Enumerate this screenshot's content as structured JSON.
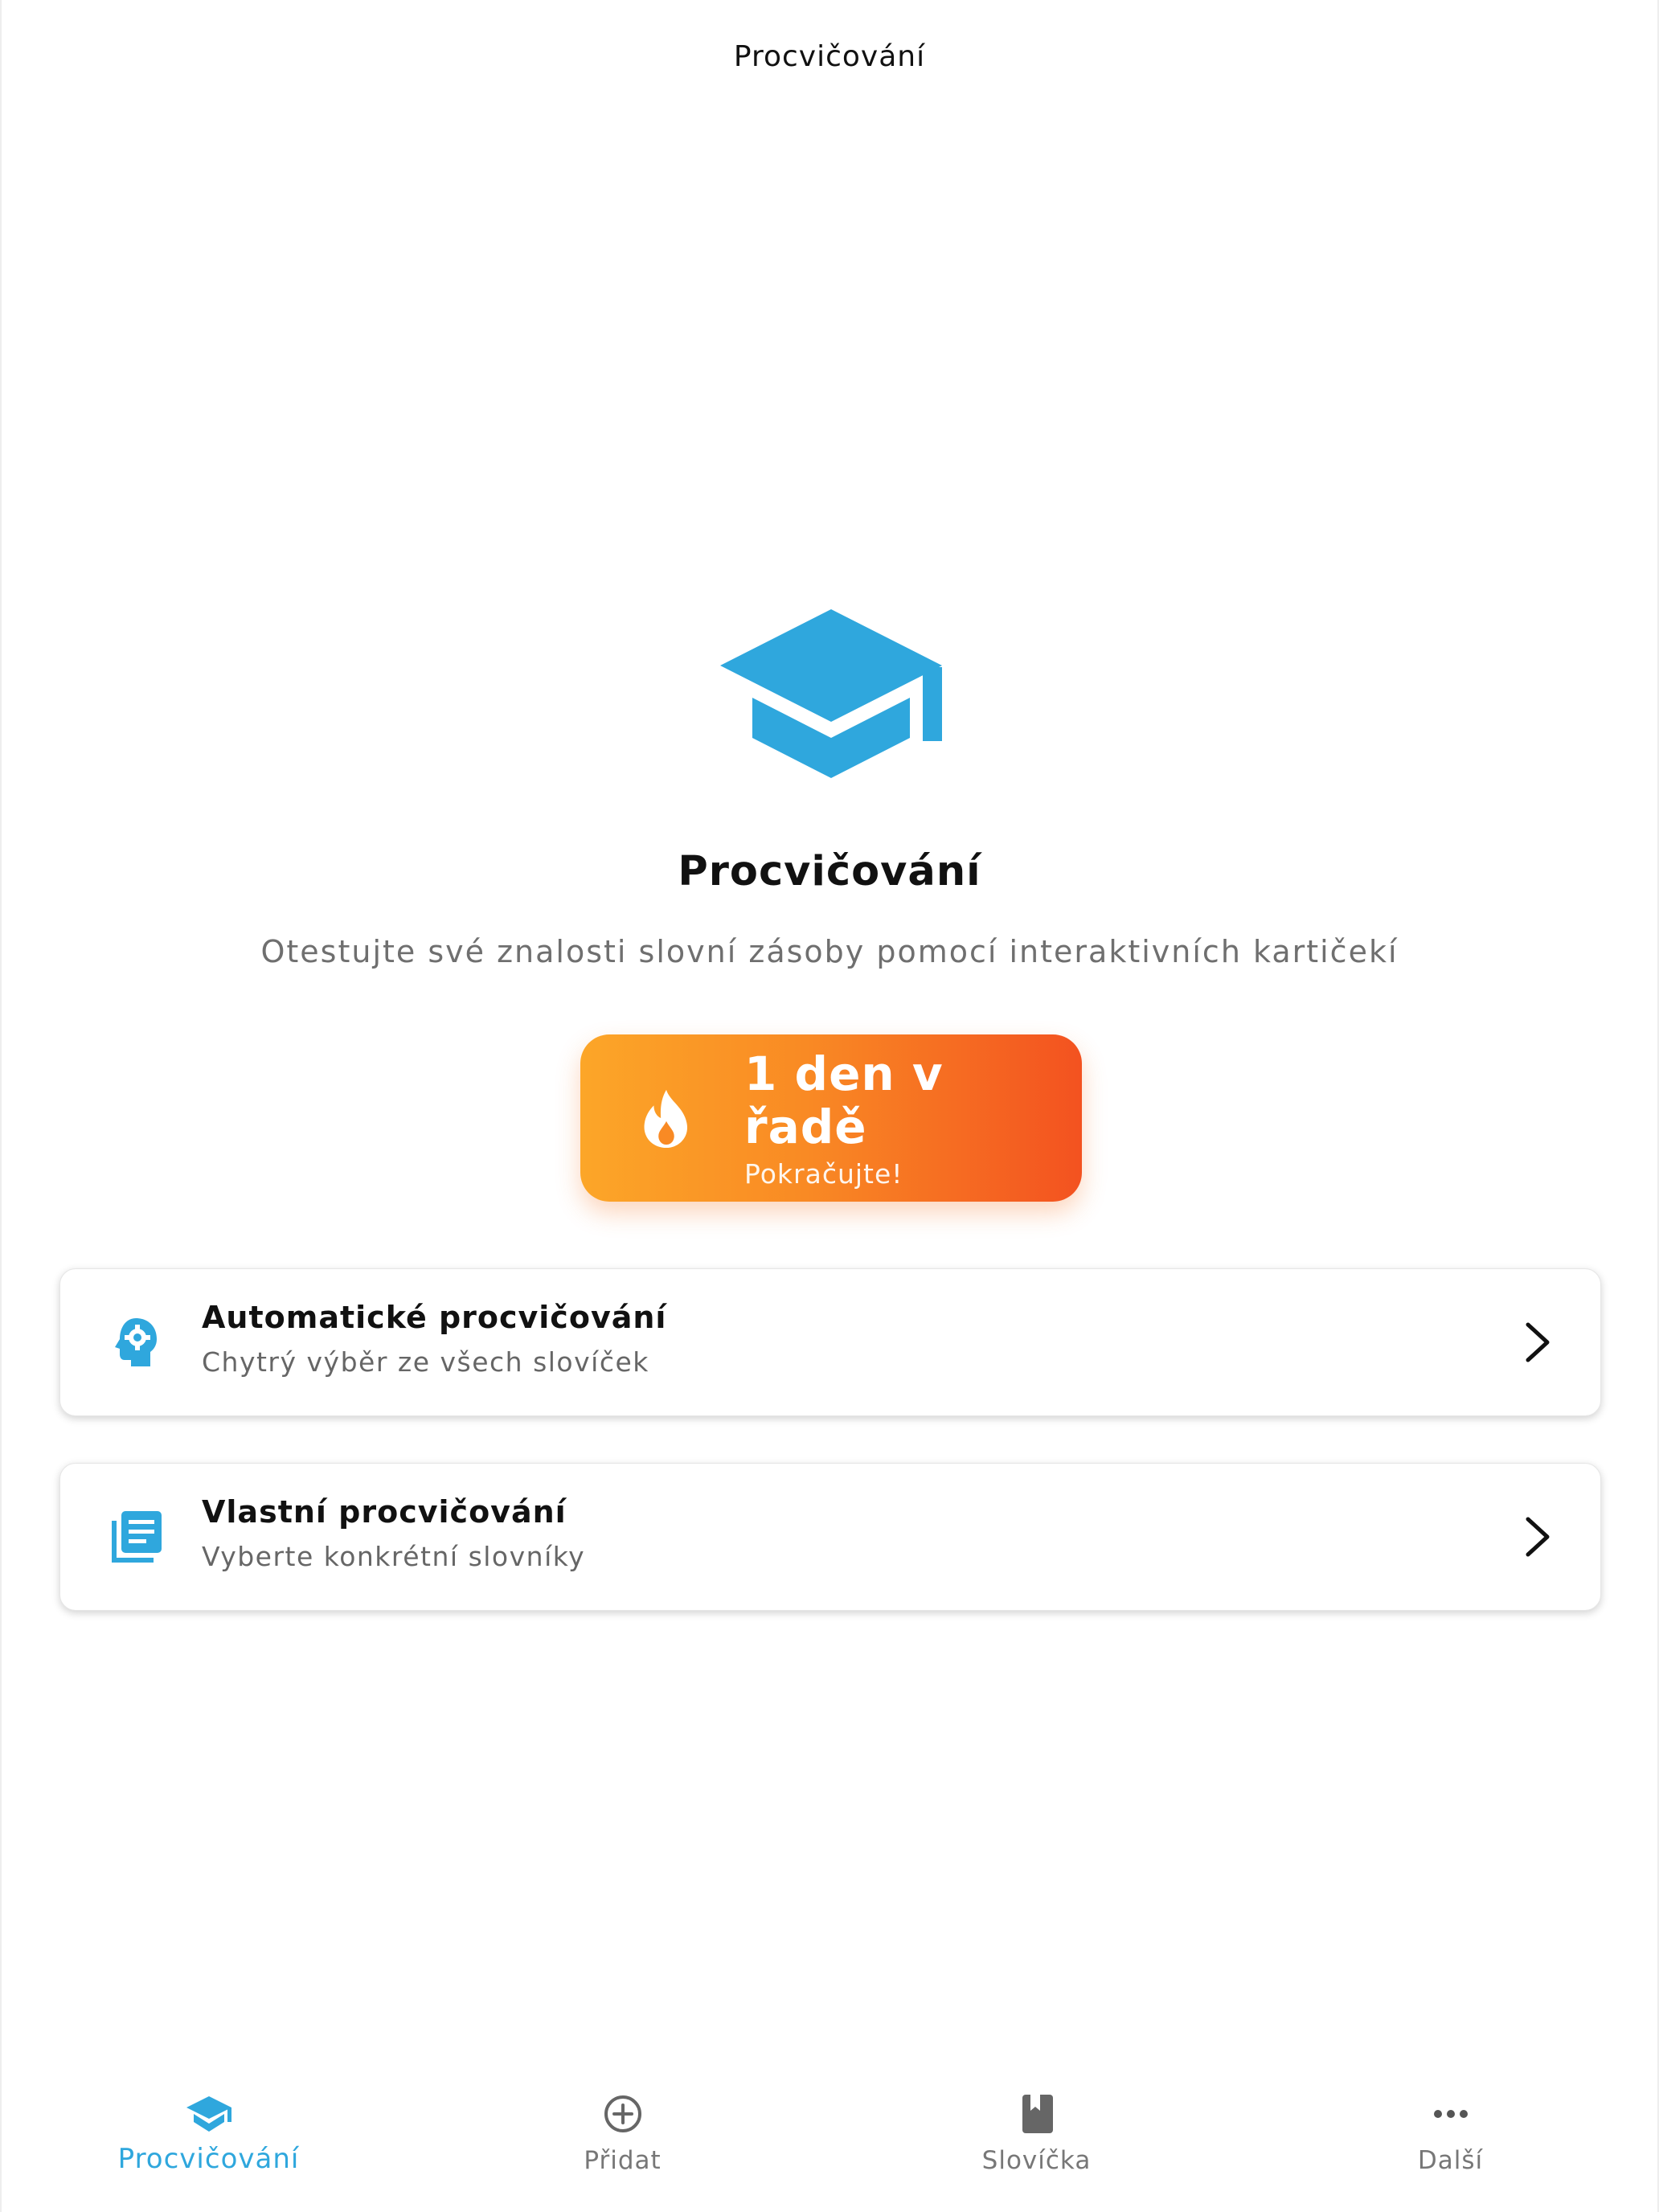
{
  "app": {
    "title": "Procvičování",
    "accent_color": "#2fa7dd",
    "streak_gradient": [
      "#fca628",
      "#f35220"
    ]
  },
  "hero": {
    "icon": "graduation-cap-icon",
    "title": "Procvičování",
    "subtitle": "Otestujte své znalosti slovní zásoby pomocí interaktivních kartičekí"
  },
  "streak": {
    "icon": "flame-icon",
    "count_label": "1 den v řadě",
    "sub_label": "Pokračujte!"
  },
  "options": [
    {
      "icon": "brain-gear-icon",
      "title": "Automatické procvičování",
      "subtitle": "Chytrý výběr ze všech slovíček"
    },
    {
      "icon": "library-books-icon",
      "title": "Vlastní procvičování",
      "subtitle": "Vyberte konkrétní slovníky"
    }
  ],
  "bottom_nav": [
    {
      "label": "Procvičování",
      "icon": "graduation-cap-icon",
      "active": true
    },
    {
      "label": "Přidat",
      "icon": "add-circle-icon",
      "active": false
    },
    {
      "label": "Slovíčka",
      "icon": "book-icon",
      "active": false
    },
    {
      "label": "Další",
      "icon": "more-dots-icon",
      "active": false
    }
  ]
}
